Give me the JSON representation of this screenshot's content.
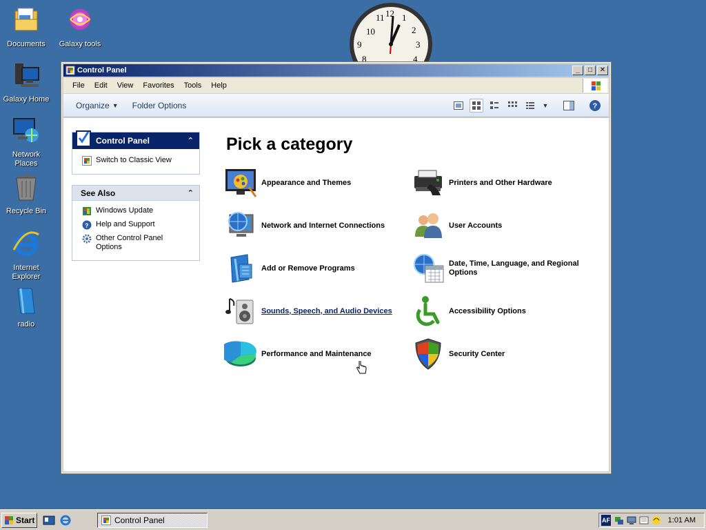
{
  "desktop": {
    "icons": [
      {
        "label": "Documents"
      },
      {
        "label": "Galaxy tools"
      },
      {
        "label": "Galaxy Home"
      },
      {
        "label": "Network Places"
      },
      {
        "label": "Recycle Bin"
      },
      {
        "label": "Internet Explorer"
      },
      {
        "label": "radio"
      }
    ]
  },
  "window": {
    "title": "Control Panel",
    "menu": [
      "File",
      "Edit",
      "View",
      "Favorites",
      "Tools",
      "Help"
    ],
    "toolbar": {
      "organize": "Organize",
      "folder_options": "Folder Options"
    }
  },
  "sidebar": {
    "panel1": {
      "title": "Control Panel",
      "items": [
        {
          "label": "Switch to Classic View"
        }
      ]
    },
    "panel2": {
      "title": "See Also",
      "items": [
        {
          "label": "Windows Update"
        },
        {
          "label": "Help and Support"
        },
        {
          "label": "Other Control Panel Options"
        }
      ]
    }
  },
  "main": {
    "heading": "Pick a category",
    "categories": [
      {
        "label": "Appearance and Themes",
        "icon": "appearance-icon"
      },
      {
        "label": "Printers and Other Hardware",
        "icon": "printer-icon"
      },
      {
        "label": "Network and Internet Connections",
        "icon": "network-icon"
      },
      {
        "label": "User Accounts",
        "icon": "users-icon"
      },
      {
        "label": "Add or Remove Programs",
        "icon": "programs-icon"
      },
      {
        "label": "Date, Time, Language, and Regional Options",
        "icon": "datetime-icon"
      },
      {
        "label": "Sounds, Speech, and Audio Devices",
        "icon": "sound-icon"
      },
      {
        "label": "Accessibility Options",
        "icon": "accessibility-icon"
      },
      {
        "label": "Performance and Maintenance",
        "icon": "performance-icon"
      },
      {
        "label": "Security Center",
        "icon": "security-icon"
      }
    ]
  },
  "taskbar": {
    "start_label": "Start",
    "task_label": "Control Panel",
    "lang": "AF",
    "time": "1:01 AM"
  },
  "clock": {
    "numbers": [
      "10",
      "11",
      "12",
      "1",
      "2",
      "3",
      "9",
      "8",
      "4"
    ]
  }
}
